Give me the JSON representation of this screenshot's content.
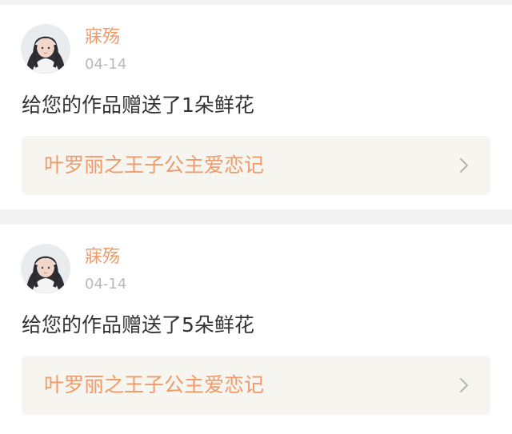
{
  "notifications": [
    {
      "username": "寐殇",
      "date": "04-14",
      "message": "给您的作品赠送了1朵鲜花",
      "work_title": "叶罗丽之王子公主爱恋记"
    },
    {
      "username": "寐殇",
      "date": "04-14",
      "message": "给您的作品赠送了5朵鲜花",
      "work_title": "叶罗丽之王子公主爱恋记"
    }
  ],
  "colors": {
    "accent": "#ef9a6a",
    "date_gray": "#b9b9b9",
    "text": "#333333",
    "link_bg": "#f6f5f0",
    "page_bg": "#f3f3f3"
  },
  "icons": {
    "avatar": "user-avatar",
    "chevron": "chevron-right-icon"
  }
}
